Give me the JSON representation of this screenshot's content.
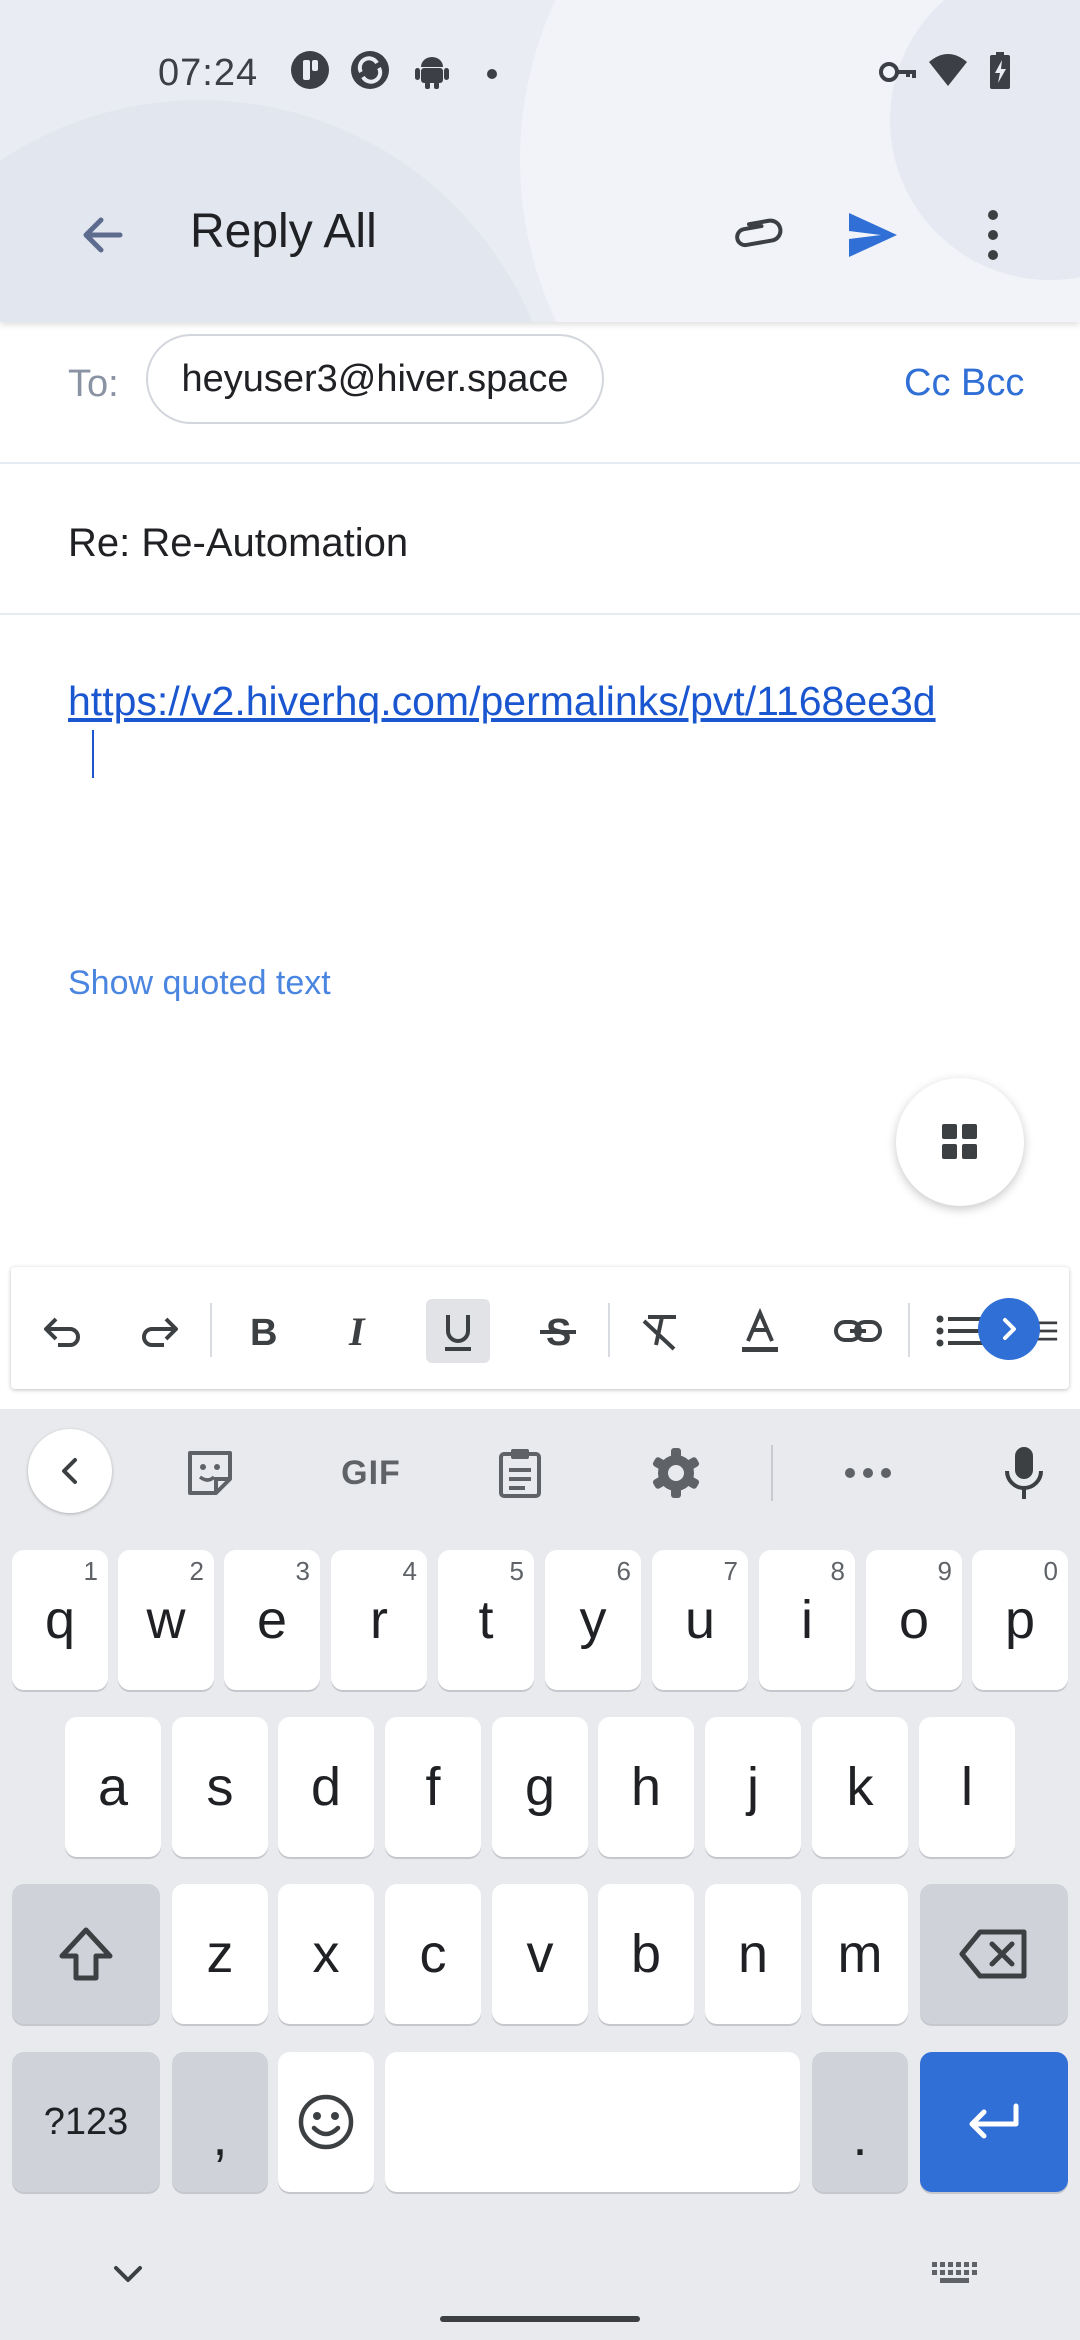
{
  "status_bar": {
    "time": "07:24",
    "icons": [
      "notification-app-icon",
      "sync-app-icon",
      "android-icon",
      "dot-icon",
      "vpn-key-icon",
      "wifi-icon",
      "battery-charging-icon"
    ]
  },
  "app_bar": {
    "title": "Reply All",
    "actions": [
      "attach-icon",
      "send-icon",
      "more-vert-icon"
    ]
  },
  "compose": {
    "to_label": "To:",
    "recipient": "heyuser3@hiver.space",
    "cc_bcc": "Cc Bcc",
    "subject": "Re: Re-Automation",
    "body_link": "https://v2.hiverhq.com/permalinks/pvt/1168ee3d",
    "show_quoted": "Show quoted text"
  },
  "formatting_toolbar": [
    "undo",
    "redo",
    "bold",
    "italic",
    "underline",
    "strikethrough",
    "clear-format",
    "text-color",
    "link",
    "bulleted-list",
    "numbered-list"
  ],
  "keyboard": {
    "toolbar": {
      "gif_label": "GIF",
      "items": [
        "back",
        "sticker",
        "gif",
        "clipboard",
        "settings",
        "more",
        "mic"
      ]
    },
    "row1": [
      {
        "key": "q",
        "hint": "1"
      },
      {
        "key": "w",
        "hint": "2"
      },
      {
        "key": "e",
        "hint": "3"
      },
      {
        "key": "r",
        "hint": "4"
      },
      {
        "key": "t",
        "hint": "5"
      },
      {
        "key": "y",
        "hint": "6"
      },
      {
        "key": "u",
        "hint": "7"
      },
      {
        "key": "i",
        "hint": "8"
      },
      {
        "key": "o",
        "hint": "9"
      },
      {
        "key": "p",
        "hint": "0"
      }
    ],
    "row2": [
      "a",
      "s",
      "d",
      "f",
      "g",
      "h",
      "j",
      "k",
      "l"
    ],
    "row3": [
      "z",
      "x",
      "c",
      "v",
      "b",
      "n",
      "m"
    ],
    "row4": {
      "symbols": "?123",
      "comma": ",",
      "period": "."
    }
  },
  "colors": {
    "accent": "#2f6fd6",
    "link": "#1a56d0",
    "appbar_bg": "#e9ecf3",
    "keyboard_bg": "#e8eaed"
  }
}
